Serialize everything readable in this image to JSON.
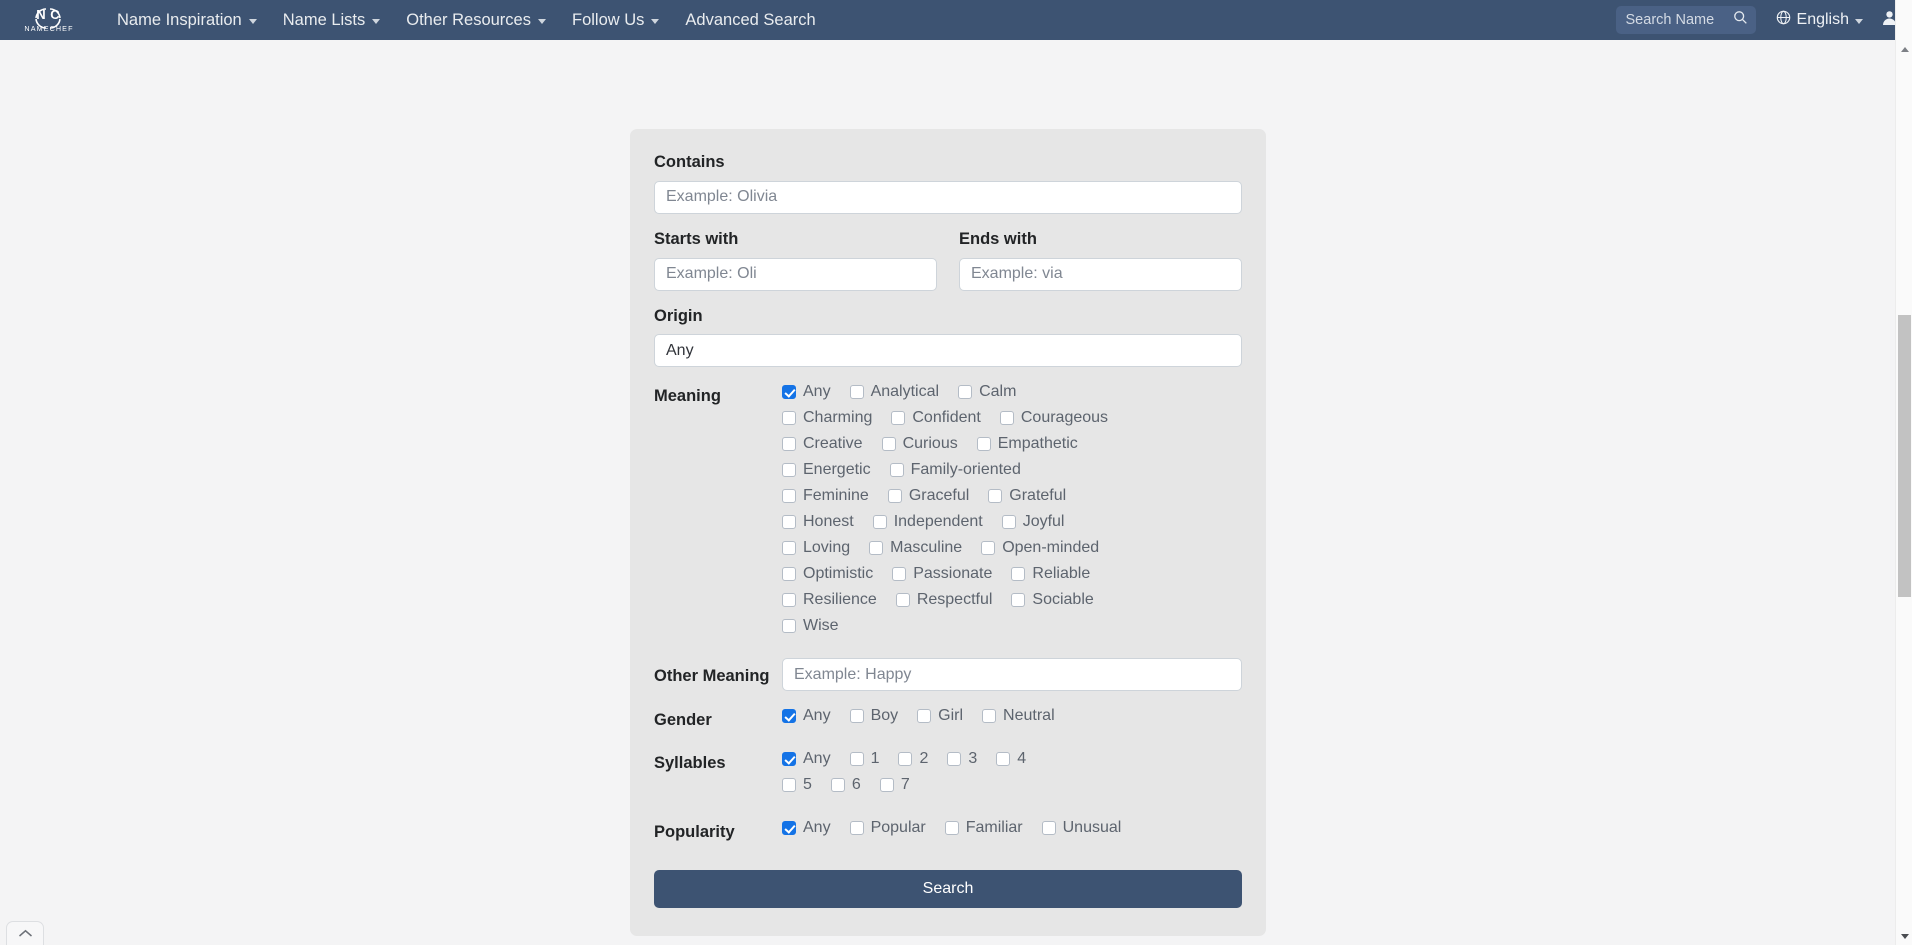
{
  "navbar": {
    "brand": {
      "name": "NameChef",
      "monogram": "NC",
      "wordmark": "N A M E C H E F"
    },
    "links": [
      {
        "label": "Name Inspiration",
        "has_caret": true
      },
      {
        "label": "Name Lists",
        "has_caret": true
      },
      {
        "label": "Other Resources",
        "has_caret": true
      },
      {
        "label": "Follow Us",
        "has_caret": true
      },
      {
        "label": "Advanced Search",
        "has_caret": false
      }
    ],
    "search": {
      "placeholder": "Search Name",
      "value": "",
      "icon": "search-icon"
    },
    "language": {
      "label": "English",
      "icon": "globe-icon",
      "has_caret": true
    },
    "account": {
      "icon": "user-icon"
    }
  },
  "form": {
    "contains": {
      "label": "Contains",
      "placeholder": "Example: Olivia",
      "value": ""
    },
    "starts_with": {
      "label": "Starts with",
      "placeholder": "Example: Oli",
      "value": ""
    },
    "ends_with": {
      "label": "Ends with",
      "placeholder": "Example: via",
      "value": ""
    },
    "origin": {
      "label": "Origin",
      "value": "Any",
      "options": [
        "Any"
      ]
    },
    "meaning": {
      "label": "Meaning",
      "options": [
        {
          "label": "Any",
          "checked": true
        },
        {
          "label": "Analytical",
          "checked": false
        },
        {
          "label": "Calm",
          "checked": false
        },
        {
          "label": "Charming",
          "checked": false
        },
        {
          "label": "Confident",
          "checked": false
        },
        {
          "label": "Courageous",
          "checked": false
        },
        {
          "label": "Creative",
          "checked": false
        },
        {
          "label": "Curious",
          "checked": false
        },
        {
          "label": "Empathetic",
          "checked": false
        },
        {
          "label": "Energetic",
          "checked": false
        },
        {
          "label": "Family-oriented",
          "checked": false
        },
        {
          "label": "Feminine",
          "checked": false
        },
        {
          "label": "Graceful",
          "checked": false
        },
        {
          "label": "Grateful",
          "checked": false
        },
        {
          "label": "Honest",
          "checked": false
        },
        {
          "label": "Independent",
          "checked": false
        },
        {
          "label": "Joyful",
          "checked": false
        },
        {
          "label": "Loving",
          "checked": false
        },
        {
          "label": "Masculine",
          "checked": false
        },
        {
          "label": "Open-minded",
          "checked": false
        },
        {
          "label": "Optimistic",
          "checked": false
        },
        {
          "label": "Passionate",
          "checked": false
        },
        {
          "label": "Reliable",
          "checked": false
        },
        {
          "label": "Resilience",
          "checked": false
        },
        {
          "label": "Respectful",
          "checked": false
        },
        {
          "label": "Sociable",
          "checked": false
        },
        {
          "label": "Wise",
          "checked": false
        }
      ]
    },
    "other_meaning": {
      "label": "Other Meaning",
      "placeholder": "Example: Happy",
      "value": ""
    },
    "gender": {
      "label": "Gender",
      "options": [
        {
          "label": "Any",
          "checked": true
        },
        {
          "label": "Boy",
          "checked": false
        },
        {
          "label": "Girl",
          "checked": false
        },
        {
          "label": "Neutral",
          "checked": false
        }
      ]
    },
    "syllables": {
      "label": "Syllables",
      "options": [
        {
          "label": "Any",
          "checked": true
        },
        {
          "label": "1",
          "checked": false
        },
        {
          "label": "2",
          "checked": false
        },
        {
          "label": "3",
          "checked": false
        },
        {
          "label": "4",
          "checked": false
        },
        {
          "label": "5",
          "checked": false
        },
        {
          "label": "6",
          "checked": false
        },
        {
          "label": "7",
          "checked": false
        }
      ]
    },
    "popularity": {
      "label": "Popularity",
      "options": [
        {
          "label": "Any",
          "checked": true
        },
        {
          "label": "Popular",
          "checked": false
        },
        {
          "label": "Familiar",
          "checked": false
        },
        {
          "label": "Unusual",
          "checked": false
        }
      ]
    },
    "submit": {
      "label": "Search"
    }
  },
  "scroll_top_button": {
    "icon": "chevron-up-icon"
  },
  "colors": {
    "navbar_bg": "#3d5372",
    "panel_bg": "#e6e6e6",
    "page_bg": "#f4f4f5",
    "accent_checked": "#1473e6",
    "button_bg": "#3d5372"
  }
}
